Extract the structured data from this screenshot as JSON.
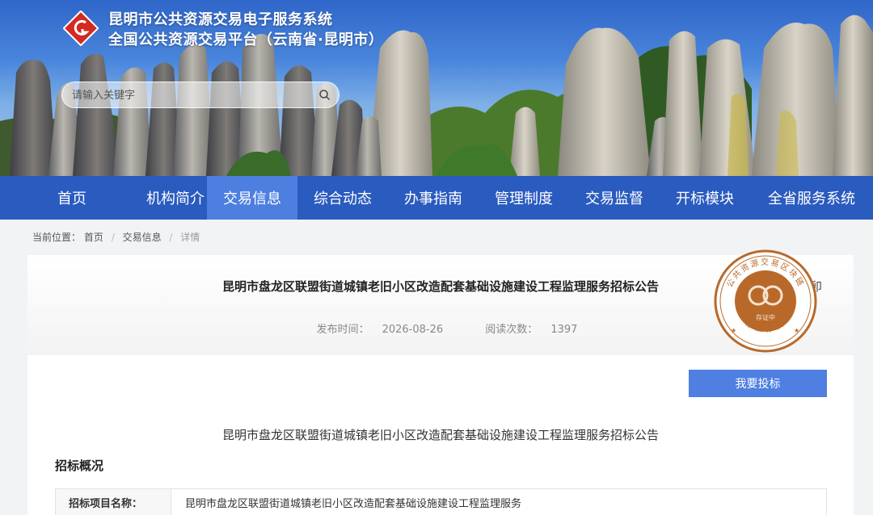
{
  "header": {
    "title_line1": "昆明市公共资源交易电子服务系统",
    "title_line2": "全国公共资源交易平台（云南省·昆明市）",
    "search_placeholder": "请输入关键字"
  },
  "nav": {
    "items": [
      "首页",
      "机构简介",
      "交易信息",
      "综合动态",
      "办事指南",
      "管理制度",
      "交易监督",
      "开标模块",
      "全省服务系统"
    ],
    "active": "交易信息"
  },
  "breadcrumb": {
    "prefix": "当前位置：",
    "items": [
      "首页",
      "交易信息",
      "详情"
    ],
    "separator": "/"
  },
  "article": {
    "title": "昆明市盘龙区联盟街道城镇老旧小区改造配套基础设施建设工程监理服务招标公告",
    "partial_char": "卯",
    "publish_label": "发布时间：",
    "publish_date": "2026-08-26",
    "views_label": "阅读次数：",
    "views": "1397",
    "bid_button": "我要投标",
    "body_title": "昆明市盘龙区联盟街道城镇老旧小区改造配套基础设施建设工程监理服务招标公告",
    "section_title": "招标概况",
    "table": {
      "label": "招标项目名称：",
      "value": "昆明市盘龙区联盟街道城镇老旧小区改造配套基础设施建设工程监理服务"
    }
  },
  "seal": {
    "top_text": "公共资源交易区块链",
    "middle_text": "存证中",
    "bottom_text": "存证标识",
    "color": "#b8692a"
  },
  "colors": {
    "nav_bg": "#2a5bbf",
    "nav_active": "#4d7fe0",
    "button": "#4f7fe0"
  }
}
